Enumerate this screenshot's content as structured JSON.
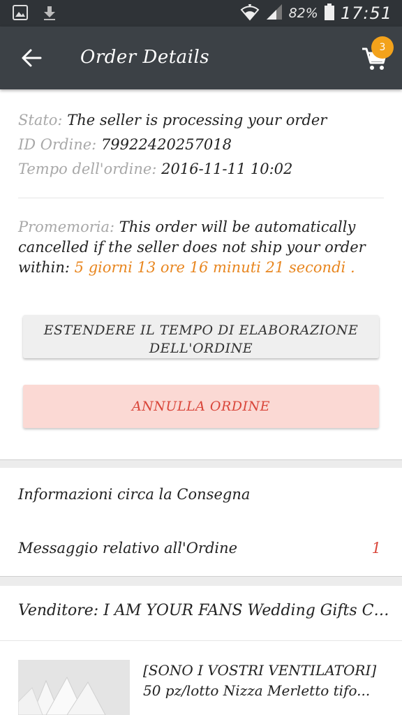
{
  "status_bar": {
    "battery_pct": "82%",
    "time": "17:51"
  },
  "app_bar": {
    "title": "Order Details",
    "cart_count": "3"
  },
  "order": {
    "status_label": "Stato:",
    "status_value": "The seller is processing your order",
    "id_label": "ID Ordine:",
    "id_value": "79922420257018",
    "time_label": "Tempo dell'ordine:",
    "time_value": "2016-11-11 10:02"
  },
  "reminder": {
    "label": "Promemoria:",
    "text": "This order will be automatically cancelled if the seller does not ship your order within:",
    "countdown": "5 giorni 13 ore 16 minuti 21 secondi",
    "end": "."
  },
  "buttons": {
    "extend_line1": "ESTENDERE IL TEMPO DI ELABORAZIONE",
    "extend_line2": "DELL'ORDINE",
    "cancel": "ANNULLA ORDINE"
  },
  "sections": {
    "delivery_info": "Informazioni circa la Consegna",
    "order_message": "Messaggio relativo all'Ordine",
    "order_message_count": "1"
  },
  "seller": {
    "label": "Venditore:",
    "name": "I AM YOUR FANS Wedding Gifts CO.,L..."
  },
  "product": {
    "title_line1": "[SONO I VOSTRI VENTILATORI]",
    "title_line2": "50 pz/lotto Nizza Merletto tifo..."
  },
  "colors": {
    "app_bar": "#3c4146",
    "status_bar": "#2f3337",
    "badge": "#f3a21b",
    "countdown": "#e8861f",
    "cancel_text": "#d9463a",
    "cancel_bg": "#fbd9d4"
  },
  "icons": [
    "image-icon",
    "download-icon",
    "wifi-icon",
    "signal-icon",
    "battery-icon",
    "back-arrow-icon",
    "cart-icon"
  ]
}
